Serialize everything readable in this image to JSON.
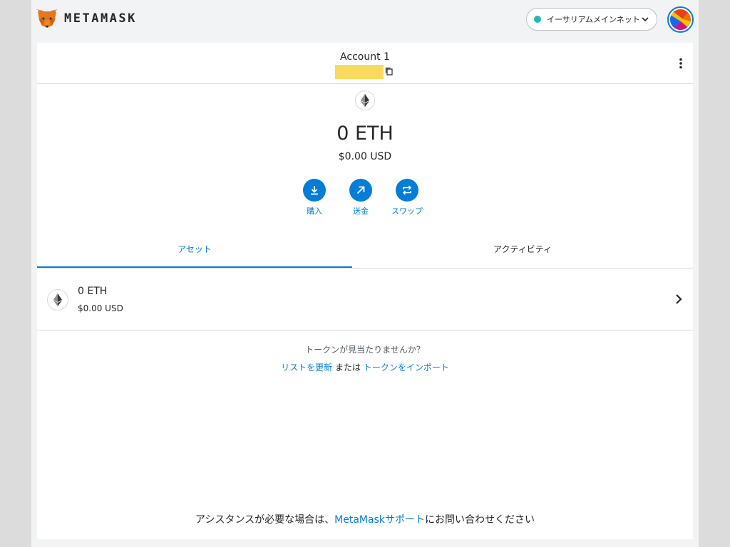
{
  "header": {
    "logo_text": "METAMASK",
    "network_label": "イーサリアムメインネット",
    "network_status_color": "#29b6af"
  },
  "account": {
    "name": "Account 1"
  },
  "balance": {
    "amount": "0 ETH",
    "usd": "$0.00 USD"
  },
  "actions": {
    "buy": "購入",
    "send": "送金",
    "swap": "スワップ"
  },
  "tabs": {
    "assets": "アセット",
    "activity": "アクティビティ"
  },
  "assets": [
    {
      "amount": "0 ETH",
      "usd": "$0.00 USD",
      "icon": "ethereum-icon"
    }
  ],
  "token_help": {
    "question": "トークンが見当たりませんか？",
    "refresh_link": "リストを更新",
    "or_text": " または ",
    "import_link": "トークンをインポート"
  },
  "support": {
    "prefix": "アシスタンスが必要な場合は、",
    "link": "MetaMaskサポート",
    "suffix": "にお問い合わせください"
  },
  "colors": {
    "accent": "#037dd6",
    "address_highlight": "#fada5e",
    "fox": "#e2761b"
  }
}
